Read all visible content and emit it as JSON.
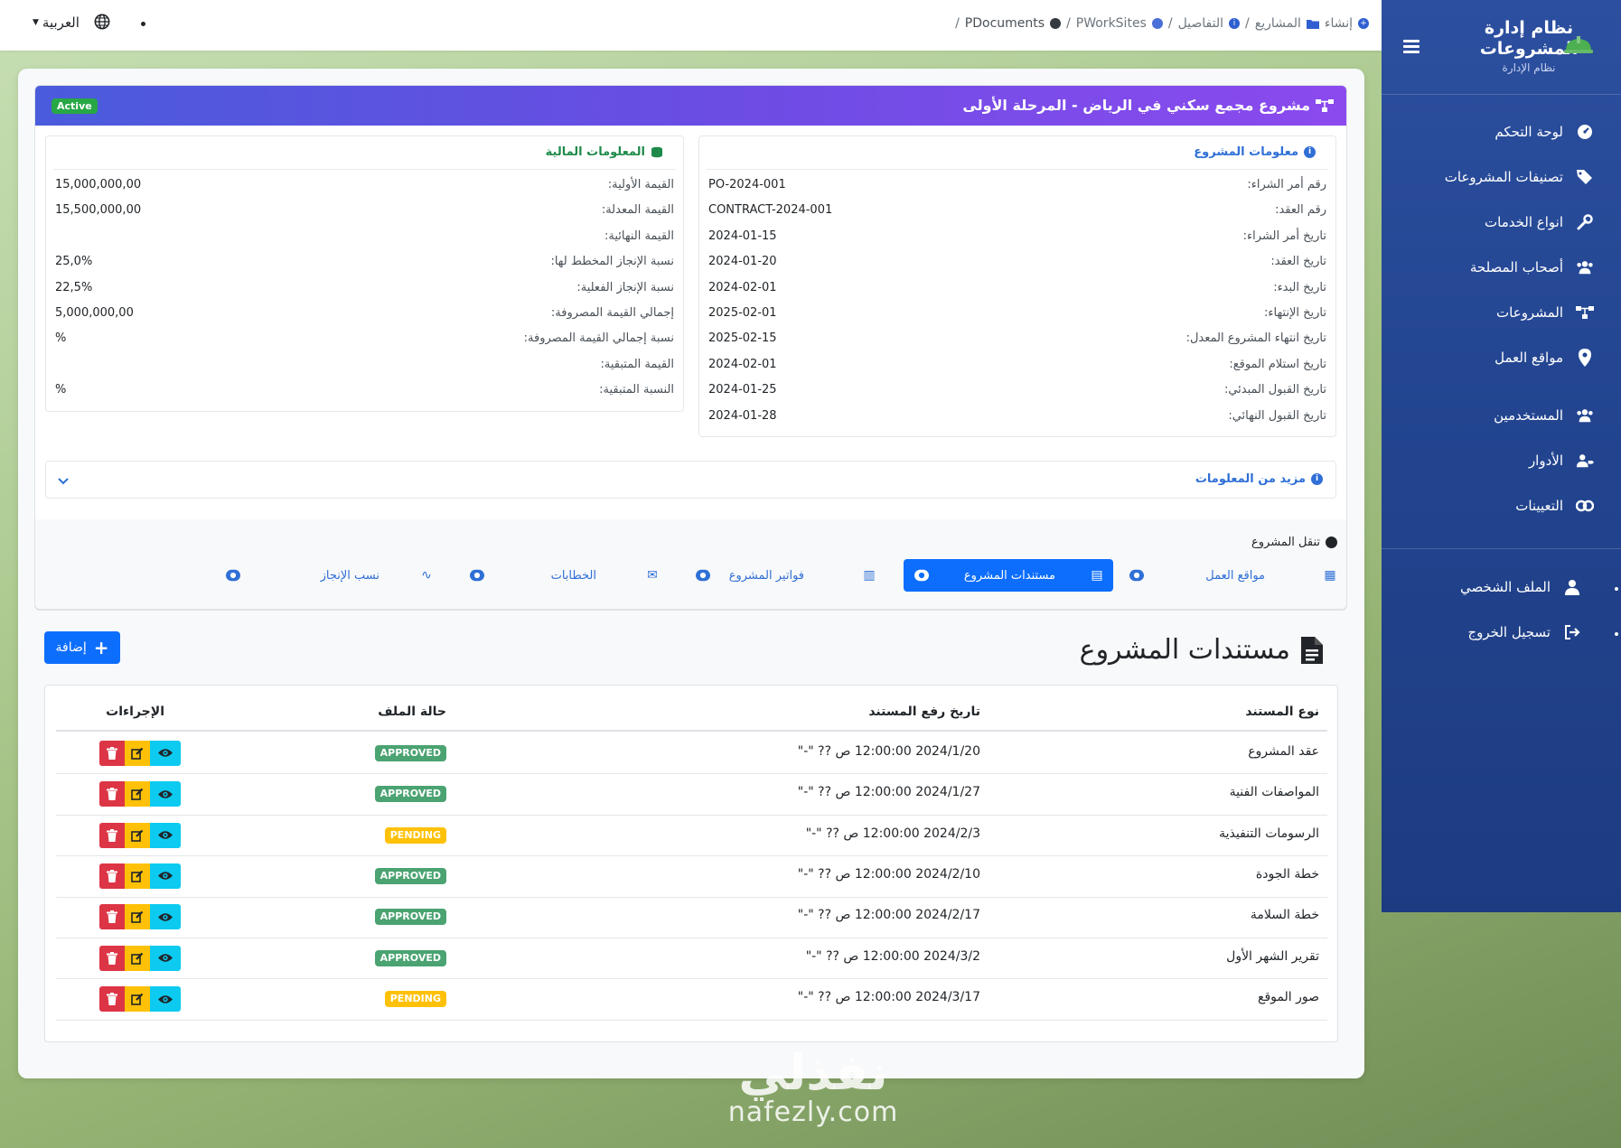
{
  "topbar": {
    "language": "العربية",
    "breadcrumb": [
      {
        "label": "إنشاء",
        "icon": "plus-circle-icon"
      },
      {
        "label": "المشاريع",
        "icon": "folder-icon"
      },
      {
        "label": "التفاصيل",
        "icon": "info-circle-icon"
      },
      {
        "label": "PWorkSites",
        "icon": "circle-icon"
      },
      {
        "label": "PDocuments",
        "icon": "circle-icon"
      }
    ]
  },
  "sidebar": {
    "title": "نظام إدارة المشروعات",
    "subtitle": "نظام الإدارة",
    "items": [
      {
        "label": "لوحة التحكم",
        "icon": "gauge-icon"
      },
      {
        "label": "تصنيفات المشروعات",
        "icon": "tags-icon"
      },
      {
        "label": "انواع الخدمات",
        "icon": "wrench-icon"
      },
      {
        "label": "أصحاب المصلحة",
        "icon": "users-icon"
      },
      {
        "label": "المشروعات",
        "icon": "project-diagram-icon"
      },
      {
        "label": "مواقع العمل",
        "icon": "map-marker-icon"
      },
      {
        "label": "المستخدمين",
        "icon": "users-icon"
      },
      {
        "label": "الأدوار",
        "icon": "user-tag-icon"
      },
      {
        "label": "التعيينات",
        "icon": "link-icon"
      }
    ],
    "profile": {
      "label": "الملف الشخصي",
      "icon": "user-icon"
    },
    "logout": {
      "label": "تسجيل الخروج",
      "icon": "sign-out-icon"
    }
  },
  "project": {
    "title": "مشروع مجمع سكني في الرياض - المرحلة الأولى",
    "status": "Active",
    "info_title": "معلومات المشروع",
    "info": [
      {
        "label": "رقم أمر الشراء:",
        "value": "PO-2024-001"
      },
      {
        "label": "رقم العقد:",
        "value": "CONTRACT-2024-001"
      },
      {
        "label": "تاريخ أمر الشراء:",
        "value": "2024-01-15"
      },
      {
        "label": "تاريخ العقد:",
        "value": "2024-01-20"
      },
      {
        "label": "تاريخ البدء:",
        "value": "2024-02-01"
      },
      {
        "label": "تاريخ الإنتهاء:",
        "value": "2025-02-01"
      },
      {
        "label": "تاريخ انتهاء المشروع المعدل:",
        "value": "2025-02-15"
      },
      {
        "label": "تاريخ استلام الموقع:",
        "value": "2024-02-01"
      },
      {
        "label": "تاريخ القبول المبدئي:",
        "value": "2024-01-25"
      },
      {
        "label": "تاريخ القبول النهائي:",
        "value": "2024-01-28"
      }
    ],
    "financial_title": "المعلومات المالية",
    "financial": [
      {
        "label": "القيمة الأولية:",
        "value": "15,000,000,00"
      },
      {
        "label": "القيمة المعدلة:",
        "value": "15,500,000,00"
      },
      {
        "label": "القيمة النهائية:",
        "value": ""
      },
      {
        "label": "نسبة الإنجاز المخطط لها:",
        "value": "25,0%"
      },
      {
        "label": "نسبة الإنجاز الفعلية:",
        "value": "22,5%"
      },
      {
        "label": "إجمالي القيمة المصروفة:",
        "value": "5,000,000,00"
      },
      {
        "label": "نسبة إجمالي القيمة المصروفة:",
        "value": "%"
      },
      {
        "label": "القيمة المتبقية:",
        "value": ""
      },
      {
        "label": "النسبة المتبقية:",
        "value": "%"
      }
    ],
    "more_info": "مزيد من المعلومات"
  },
  "nav": {
    "label": "تنقل المشروع",
    "items": [
      {
        "label": "مواقع العمل",
        "icon": "map-icon",
        "active": false
      },
      {
        "label": "مستندات المشروع",
        "icon": "file-icon",
        "active": true
      },
      {
        "label": "فواتير المشروع",
        "icon": "invoice-icon",
        "active": false
      },
      {
        "label": "الخطابات",
        "icon": "envelope-icon",
        "active": false
      },
      {
        "label": "نسب الإنجاز",
        "icon": "chart-line-icon",
        "active": false
      }
    ]
  },
  "documents": {
    "title": "مستندات المشروع",
    "add_label": "إضافة",
    "columns": [
      "نوع المستند",
      "تاريخ رفع المستند",
      "حالة الملف",
      "الإجراءات"
    ],
    "rows": [
      {
        "type": "عقد المشروع",
        "date": "2024/1/20 12:00:00 ص ?? \"-\"",
        "status": "APPROVED"
      },
      {
        "type": "المواصفات الفنية",
        "date": "2024/1/27 12:00:00 ص ?? \"-\"",
        "status": "APPROVED"
      },
      {
        "type": "الرسومات التنفيذية",
        "date": "2024/2/3 12:00:00 ص ?? \"-\"",
        "status": "PENDING"
      },
      {
        "type": "خطة الجودة",
        "date": "2024/2/10 12:00:00 ص ?? \"-\"",
        "status": "APPROVED"
      },
      {
        "type": "خطة السلامة",
        "date": "2024/2/17 12:00:00 ص ?? \"-\"",
        "status": "APPROVED"
      },
      {
        "type": "تقرير الشهر الأول",
        "date": "2024/3/2 12:00:00 ص ?? \"-\"",
        "status": "APPROVED"
      },
      {
        "type": "صور الموقع",
        "date": "2024/3/17 12:00:00 ص ?? \"-\"",
        "status": "PENDING"
      }
    ]
  },
  "watermark": {
    "arabic": "نفذلي",
    "latin": "nafezly.com"
  },
  "colors": {
    "primary": "#0d6efd",
    "sidebar": "#22448f",
    "approved": "#4aa371",
    "pending": "#ffc107",
    "danger": "#dc3545",
    "info": "#0dcaf0"
  }
}
